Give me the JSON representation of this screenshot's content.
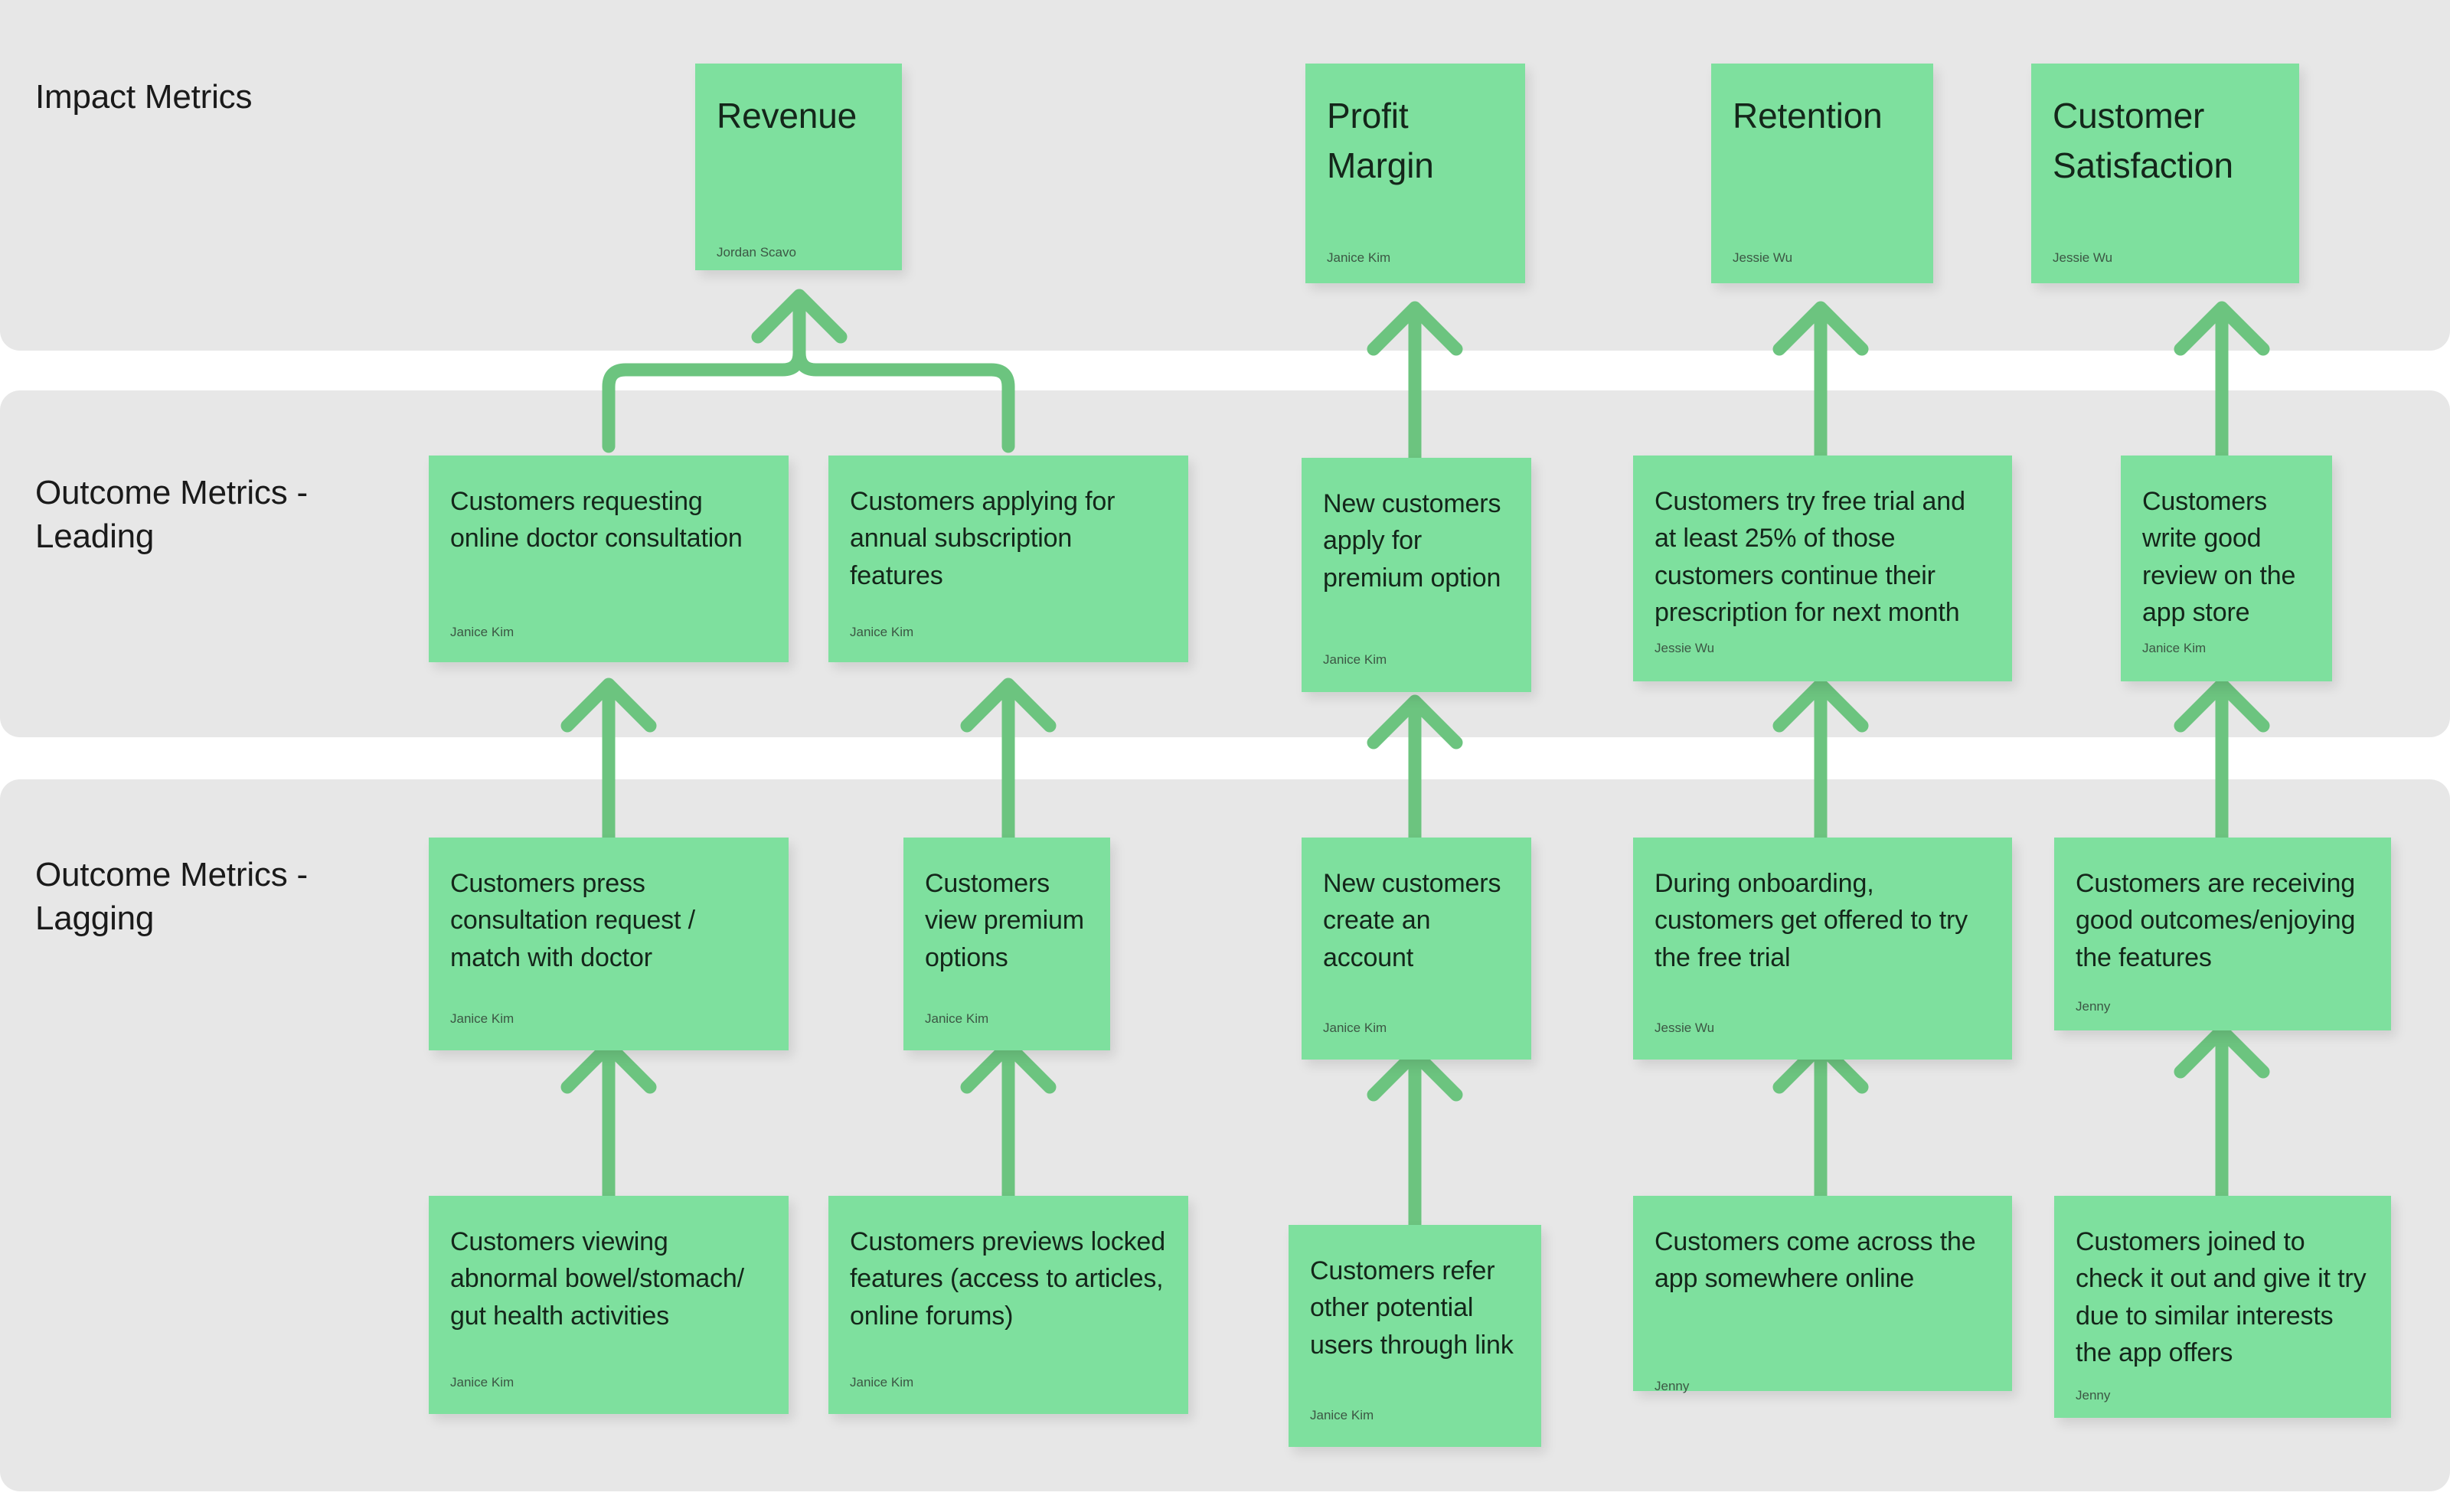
{
  "colors": {
    "board_background": "#ffffff",
    "band_background": "#e7e7e7",
    "card_fill": "#7ee09e",
    "arrow": "#6cc47f",
    "card_text": "#14261a",
    "author_text": "#3c5744",
    "band_label_text": "#1a1a1a"
  },
  "bands": [
    {
      "id": "impact-metrics",
      "label": "Impact Metrics"
    },
    {
      "id": "outcome-metrics-leading",
      "label": "Outcome Metrics -\nLeading"
    },
    {
      "id": "outcome-metrics-lagging",
      "label": "Outcome Metrics -\nLagging"
    }
  ],
  "cards": {
    "impact": [
      {
        "id": "revenue",
        "title": "Revenue",
        "author": "Jordan Scavo"
      },
      {
        "id": "profit-margin",
        "title": "Profit\nMargin",
        "author": "Janice Kim"
      },
      {
        "id": "retention",
        "title": "Retention",
        "author": "Jessie Wu"
      },
      {
        "id": "customer-satisfaction",
        "title": "Customer\nSatisfaction",
        "author": "Jessie Wu"
      }
    ],
    "leading": [
      {
        "id": "online-doctor-consultation",
        "title": "Customers requesting online doctor consultation",
        "author": "Janice Kim"
      },
      {
        "id": "annual-subscription-features",
        "title": "Customers applying for annual subscription features",
        "author": "Janice Kim"
      },
      {
        "id": "premium-option-apply",
        "title": "New customers apply for premium option",
        "author": "Janice Kim"
      },
      {
        "id": "free-trial-continue-prescription",
        "title": "Customers try free trial and at least 25% of those customers continue their prescription for next month",
        "author": "Jessie Wu"
      },
      {
        "id": "good-review-app-store",
        "title": "Customers write good review on the app store",
        "author": "Janice Kim"
      }
    ],
    "lagging_upper": [
      {
        "id": "press-consultation-request",
        "title": "Customers press consultation request / match with doctor",
        "author": "Janice Kim"
      },
      {
        "id": "view-premium-options",
        "title": "Customers view premium options",
        "author": "Janice Kim"
      },
      {
        "id": "new-customers-create-account",
        "title": "New customers create an account",
        "author": "Janice Kim"
      },
      {
        "id": "onboarding-offer-free-trial",
        "title": "During onboarding, customers get offered to try the free trial",
        "author": "Jessie Wu"
      },
      {
        "id": "receiving-good-outcomes",
        "title": "Customers are receiving good outcomes/enjoying the features",
        "author": "Jenny"
      }
    ],
    "lagging_lower": [
      {
        "id": "viewing-gut-health-activities",
        "title": "Customers viewing abnormal bowel/stomach/ gut health activities",
        "author": "Janice Kim"
      },
      {
        "id": "previews-locked-features",
        "title": "Customers previews locked features (access to articles, online forums)",
        "author": "Janice Kim"
      },
      {
        "id": "refer-other-users",
        "title": "Customers refer other potential users through link",
        "author": "Janice Kim"
      },
      {
        "id": "come-across-app-online",
        "title": "Customers come across the app somewhere online",
        "author": "Jenny"
      },
      {
        "id": "joined-similar-interests",
        "title": "Customers joined to check it out and give it try due to similar interests the app offers",
        "author": "Jenny"
      }
    ]
  }
}
